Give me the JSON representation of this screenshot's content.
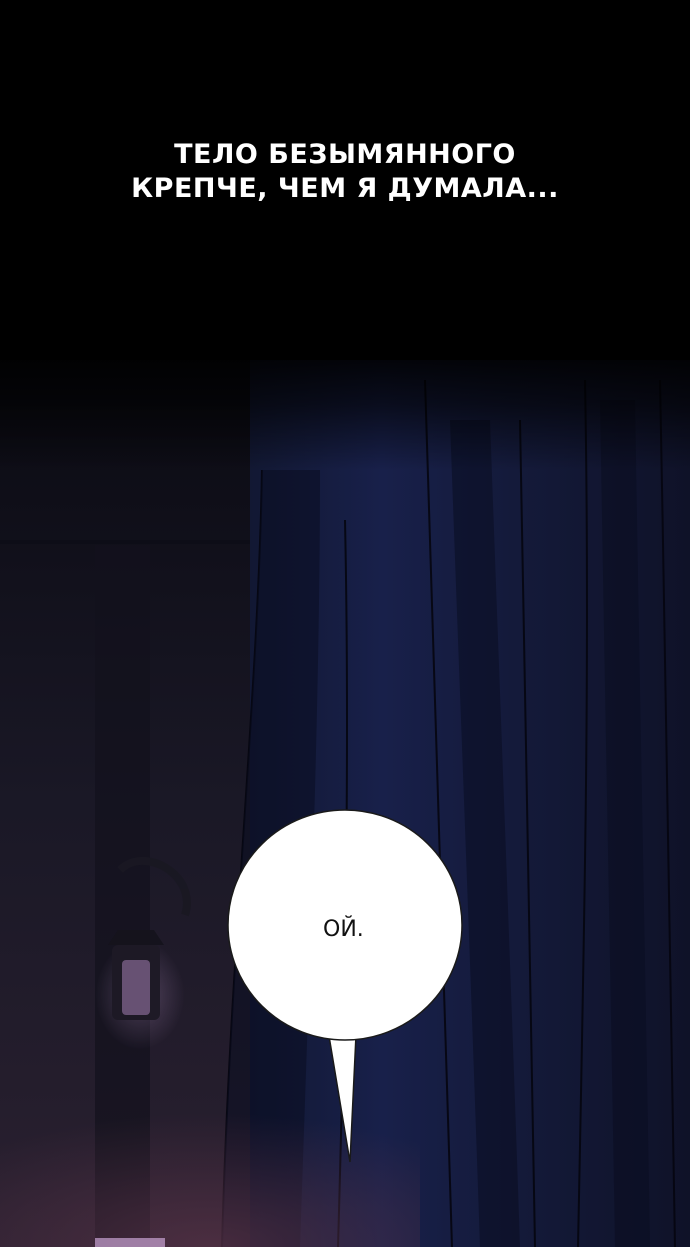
{
  "narration": {
    "line1": "ТЕЛО БЕЗЫМЯННОГО",
    "line2": "КРЕПЧЕ, ЧЕМ Я ДУМАЛА..."
  },
  "speech_bubble": {
    "text": "ОЙ."
  },
  "colors": {
    "sky": "#000000",
    "curtain": "#141a35",
    "wall": "#1c1a2c",
    "bubble": "#ffffff",
    "lamp_glow": "#c8a0d8"
  }
}
